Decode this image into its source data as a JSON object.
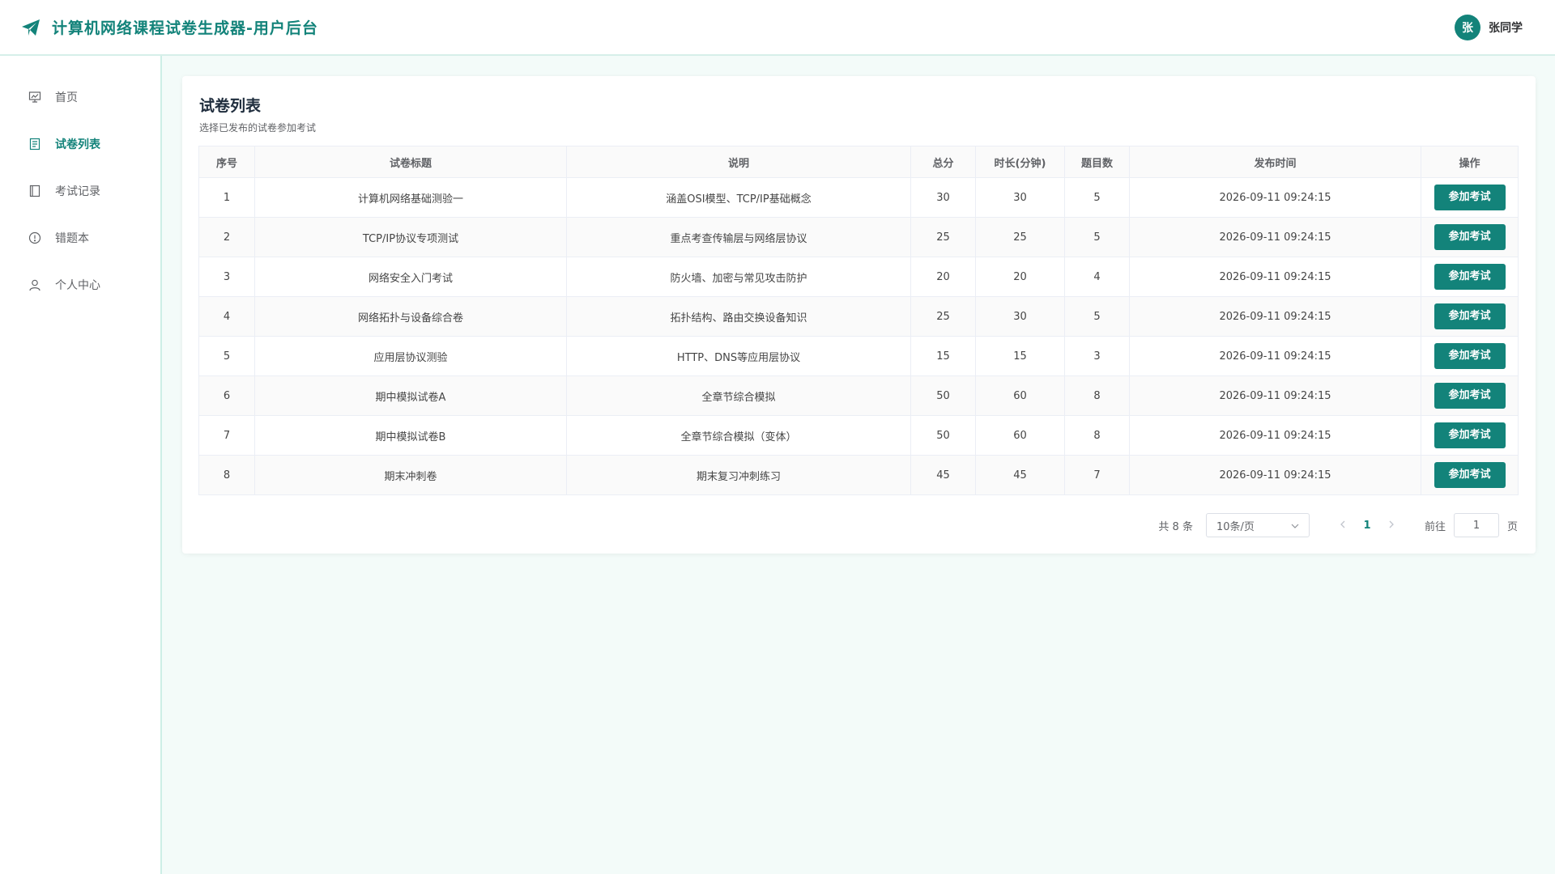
{
  "header": {
    "title": "计算机网络课程试卷生成器-用户后台",
    "logo_icon": "paper-plane-icon",
    "user_avatar": "张",
    "user_name": "张同学"
  },
  "colors": {
    "accent": "#13837a"
  },
  "sidebar": {
    "items": [
      {
        "label": "首页",
        "icon": "dashboard-icon",
        "active": false
      },
      {
        "label": "试卷列表",
        "icon": "document-icon",
        "active": true
      },
      {
        "label": "考试记录",
        "icon": "notebook-icon",
        "active": false
      },
      {
        "label": "错题本",
        "icon": "warning-circle-icon",
        "active": false
      },
      {
        "label": "个人中心",
        "icon": "user-icon",
        "active": false
      }
    ]
  },
  "main": {
    "title": "试卷列表",
    "subtitle": "选择已发布的试卷参加考试",
    "table": {
      "columns": [
        "序号",
        "试卷标题",
        "说明",
        "总分",
        "时长(分钟)",
        "题目数",
        "发布时间",
        "操作"
      ],
      "action_label": "参加考试",
      "rows": [
        [
          "1",
          "计算机网络基础测验一",
          "涵盖OSI模型、TCP/IP基础概念",
          "30",
          "30",
          "5",
          "2026-09-11 09:24:15"
        ],
        [
          "2",
          "TCP/IP协议专项测试",
          "重点考查传输层与网络层协议",
          "25",
          "25",
          "5",
          "2026-09-11 09:24:15"
        ],
        [
          "3",
          "网络安全入门考试",
          "防火墙、加密与常见攻击防护",
          "20",
          "20",
          "4",
          "2026-09-11 09:24:15"
        ],
        [
          "4",
          "网络拓扑与设备综合卷",
          "拓扑结构、路由交换设备知识",
          "25",
          "30",
          "5",
          "2026-09-11 09:24:15"
        ],
        [
          "5",
          "应用层协议测验",
          "HTTP、DNS等应用层协议",
          "15",
          "15",
          "3",
          "2026-09-11 09:24:15"
        ],
        [
          "6",
          "期中模拟试卷A",
          "全章节综合模拟",
          "50",
          "60",
          "8",
          "2026-09-11 09:24:15"
        ],
        [
          "7",
          "期中模拟试卷B",
          "全章节综合模拟（变体）",
          "50",
          "60",
          "8",
          "2026-09-11 09:24:15"
        ],
        [
          "8",
          "期末冲刺卷",
          "期末复习冲刺练习",
          "45",
          "45",
          "7",
          "2026-09-11 09:24:15"
        ]
      ]
    },
    "pagination": {
      "total": "共 8 条",
      "page_size": "10条/页",
      "current_page": "1",
      "goto_label": "前往",
      "goto_value": "1",
      "page_suffix": "页"
    }
  }
}
